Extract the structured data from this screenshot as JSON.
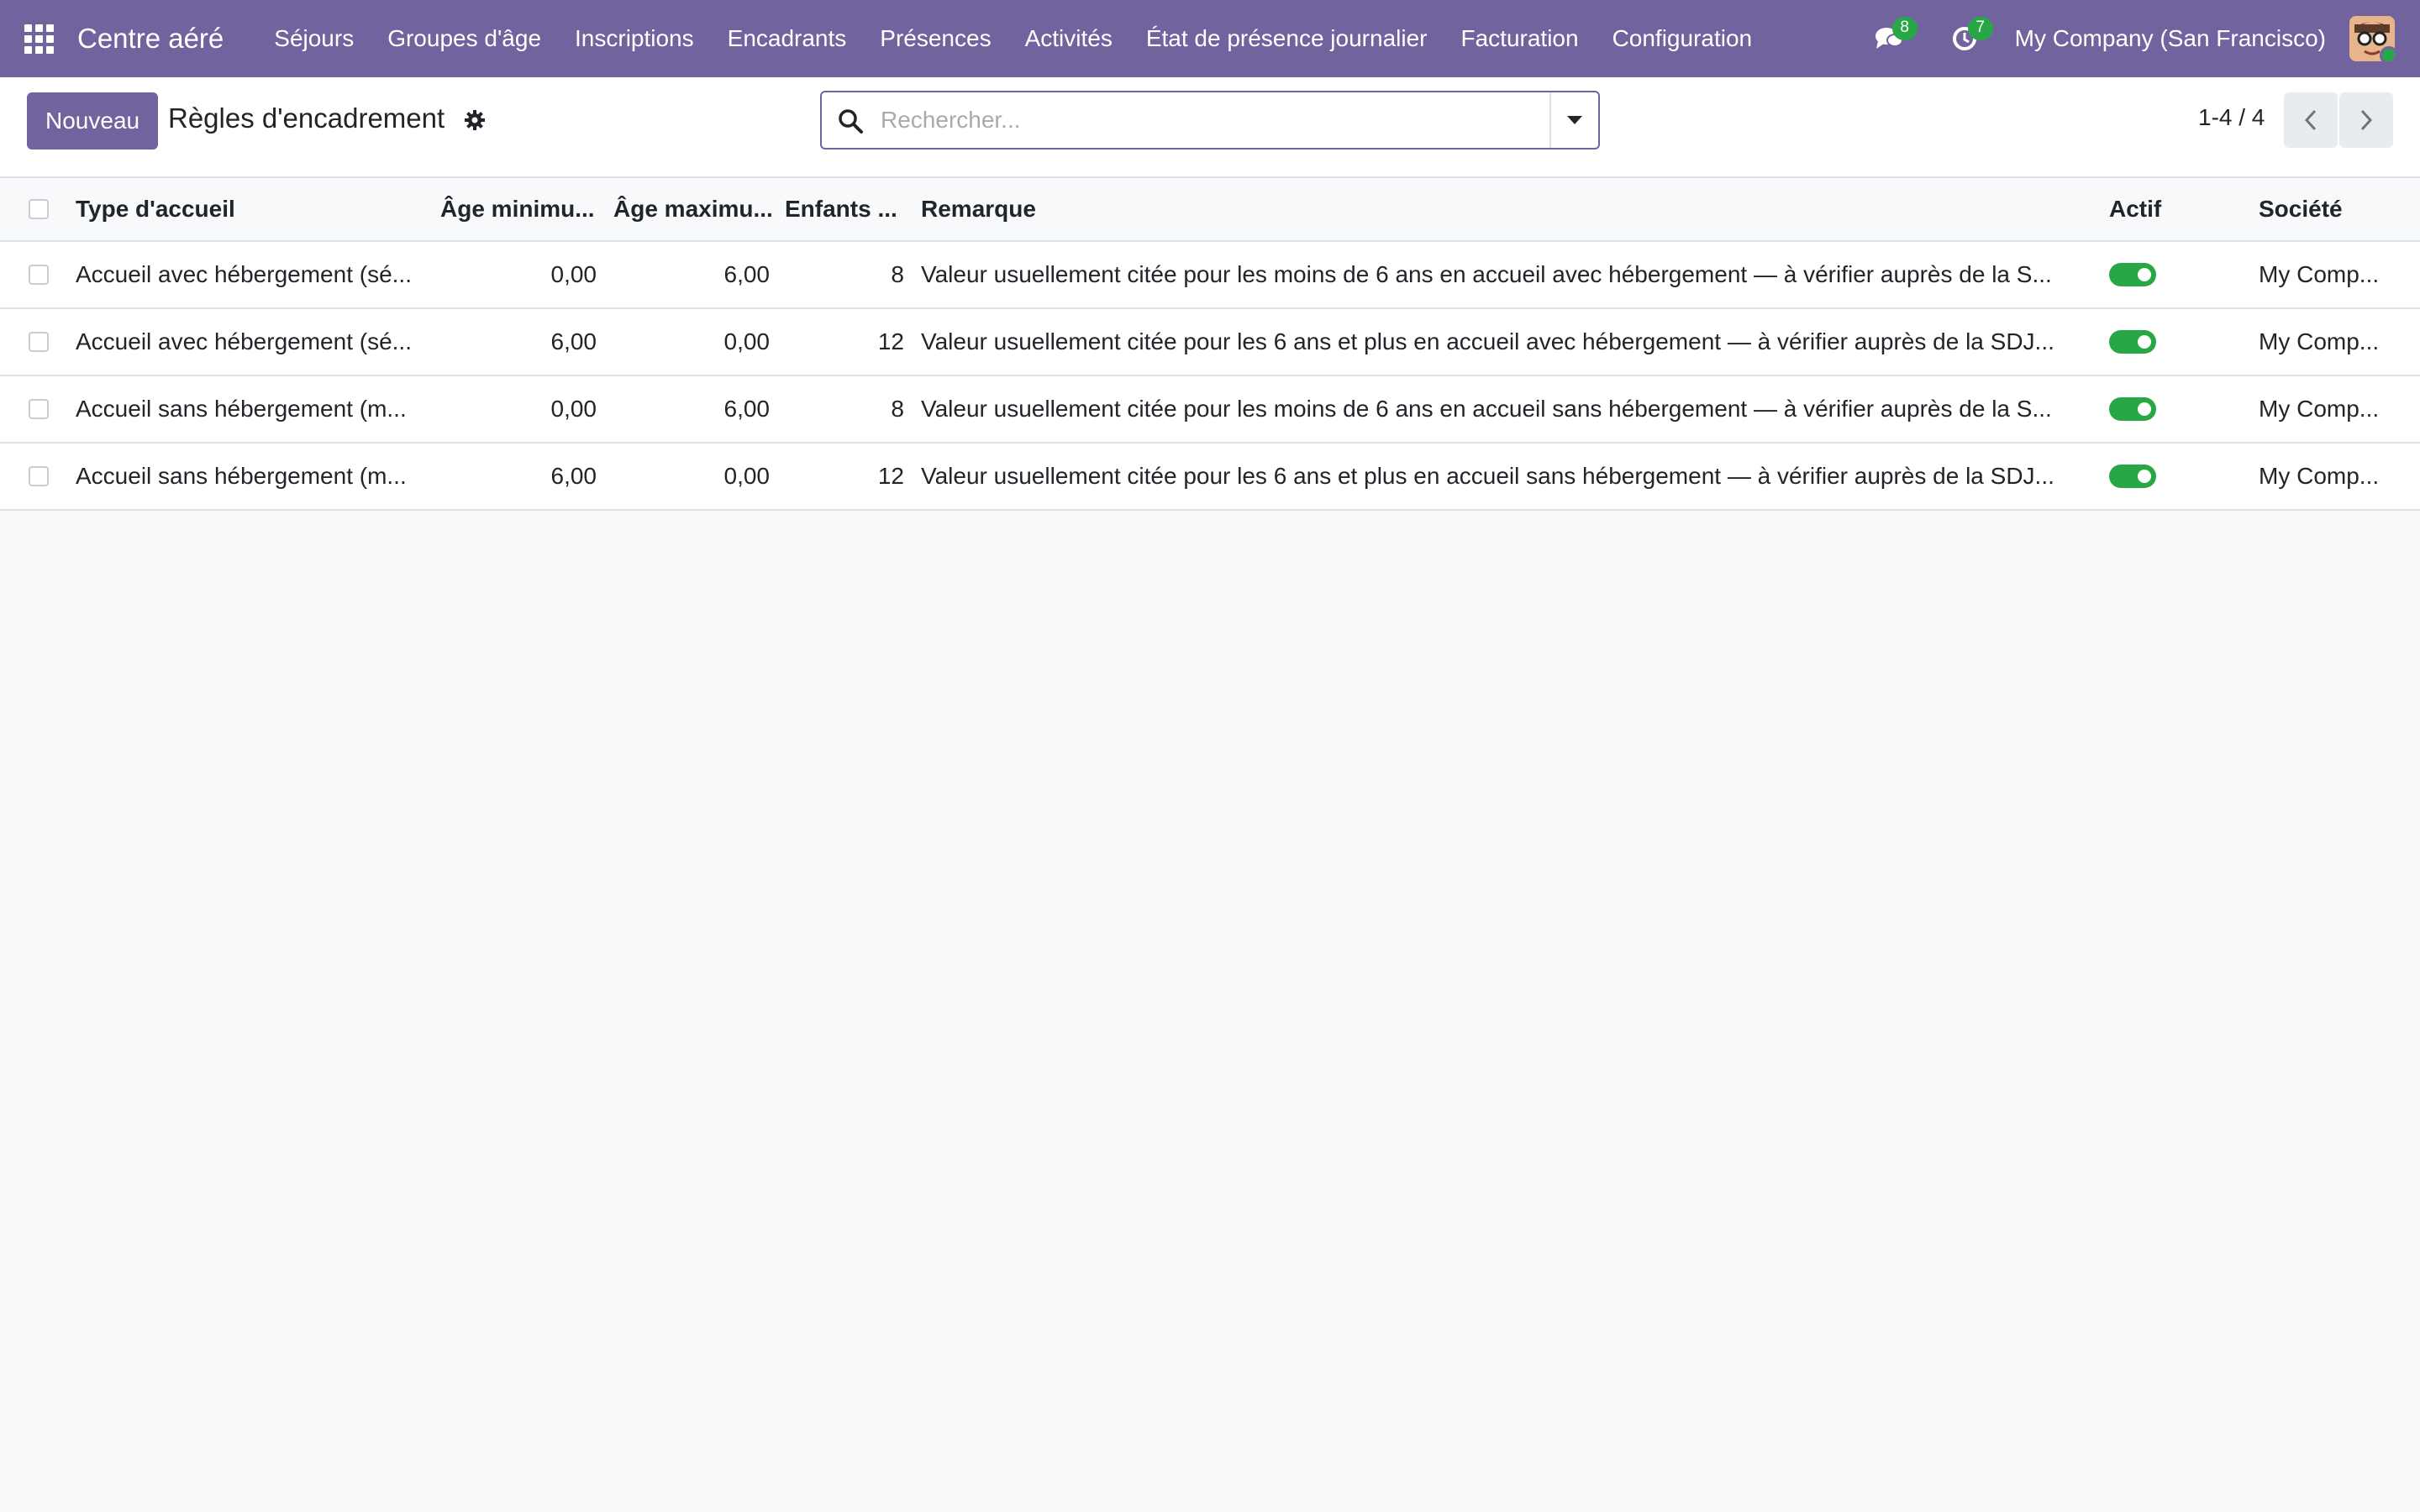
{
  "navbar": {
    "app_name": "Centre aéré",
    "menu": [
      "Séjours",
      "Groupes d'âge",
      "Inscriptions",
      "Encadrants",
      "Présences",
      "Activités",
      "État de présence journalier",
      "Facturation",
      "Configuration"
    ],
    "messages_count": "8",
    "activities_count": "7",
    "company": "My Company (San Francisco)",
    "icons": {
      "apps": "apps-grid-icon",
      "messages": "chat-icon",
      "activities": "clock-icon"
    }
  },
  "control_panel": {
    "new_label": "Nouveau",
    "title": "Règles d'encadrement",
    "search_placeholder": "Rechercher...",
    "pager": "1-4 / 4"
  },
  "table": {
    "columns": [
      "Type d'accueil",
      "Âge minimu...",
      "Âge maximu...",
      "Enfants ...",
      "Remarque",
      "Actif",
      "Société"
    ],
    "rows": [
      {
        "type": "Accueil avec hébergement (sé...",
        "age_min": "0,00",
        "age_max": "6,00",
        "children": "8",
        "remark": "Valeur usuellement citée pour les moins de 6 ans en accueil avec hébergement — à vérifier auprès de la S...",
        "active": true,
        "company": "My Comp..."
      },
      {
        "type": "Accueil avec hébergement (sé...",
        "age_min": "6,00",
        "age_max": "0,00",
        "children": "12",
        "remark": "Valeur usuellement citée pour les 6 ans et plus en accueil avec hébergement — à vérifier auprès de la SDJ...",
        "active": true,
        "company": "My Comp..."
      },
      {
        "type": "Accueil sans hébergement (m...",
        "age_min": "0,00",
        "age_max": "6,00",
        "children": "8",
        "remark": "Valeur usuellement citée pour les moins de 6 ans en accueil sans hébergement — à vérifier auprès de la S...",
        "active": true,
        "company": "My Comp..."
      },
      {
        "type": "Accueil sans hébergement (m...",
        "age_min": "6,00",
        "age_max": "0,00",
        "children": "12",
        "remark": "Valeur usuellement citée pour les 6 ans et plus en accueil sans hébergement — à vérifier auprès de la SDJ...",
        "active": true,
        "company": "My Comp..."
      }
    ]
  },
  "colors": {
    "brand": "#71639e",
    "toggle_on": "#28a745",
    "badge": "#28a745"
  }
}
